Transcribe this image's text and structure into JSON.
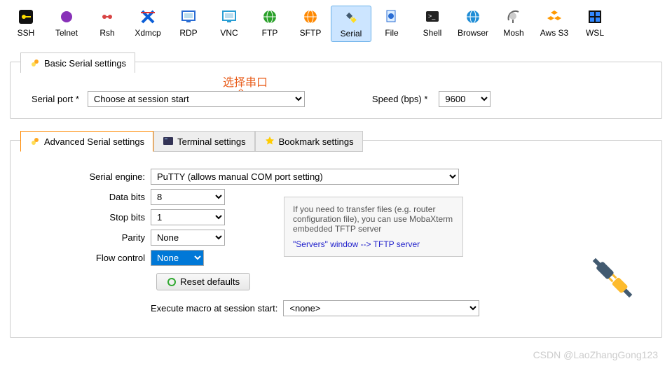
{
  "toolbar": [
    {
      "label": "SSH",
      "icon": "key",
      "c": "#000"
    },
    {
      "label": "Telnet",
      "icon": "circle",
      "c": "#8831b8"
    },
    {
      "label": "Rsh",
      "icon": "rsh",
      "c": "#d84444"
    },
    {
      "label": "Xdmcp",
      "icon": "xwin",
      "c": "#0b5ed7"
    },
    {
      "label": "RDP",
      "icon": "monitor",
      "c": "#2a6dd4"
    },
    {
      "label": "VNC",
      "icon": "monitor",
      "c": "#2a9ed4"
    },
    {
      "label": "FTP",
      "icon": "globe",
      "c": "#2aa12a"
    },
    {
      "label": "SFTP",
      "icon": "globe",
      "c": "#ff8800"
    },
    {
      "label": "Serial",
      "icon": "plug",
      "c": "#555",
      "sel": true
    },
    {
      "label": "File",
      "icon": "file",
      "c": "#2a6dd4"
    },
    {
      "label": "Shell",
      "icon": "shell",
      "c": "#000"
    },
    {
      "label": "Browser",
      "icon": "globe",
      "c": "#1f8dd6"
    },
    {
      "label": "Mosh",
      "icon": "dish",
      "c": "#666"
    },
    {
      "label": "Aws S3",
      "icon": "cubes",
      "c": "#ff9900"
    },
    {
      "label": "WSL",
      "icon": "win",
      "c": "#000"
    }
  ],
  "hint": "选择串口",
  "basicTab": "Basic Serial settings",
  "serialPortLabel": "Serial port *",
  "serialPortValue": "Choose at session start",
  "speedLabel": "Speed (bps) *",
  "speedValue": "9600",
  "advTabs": {
    "adv": "Advanced Serial settings",
    "term": "Terminal settings",
    "book": "Bookmark settings"
  },
  "engineLabel": "Serial engine:",
  "engineValue": "PuTTY    (allows manual COM port setting)",
  "dataBitsLabel": "Data bits",
  "dataBitsValue": "8",
  "stopBitsLabel": "Stop bits",
  "stopBitsValue": "1",
  "parityLabel": "Parity",
  "parityValue": "None",
  "flowLabel": "Flow control",
  "flowValue": "None",
  "resetLabel": "Reset defaults",
  "infoText": "If you need to transfer files (e.g. router configuration file), you can use MobaXterm embedded TFTP server",
  "infoLink": "\"Servers\" window  -->  TFTP server",
  "macroLabel": "Execute macro at session start:",
  "macroValue": "<none>",
  "watermark": "CSDN @LaoZhangGong123"
}
